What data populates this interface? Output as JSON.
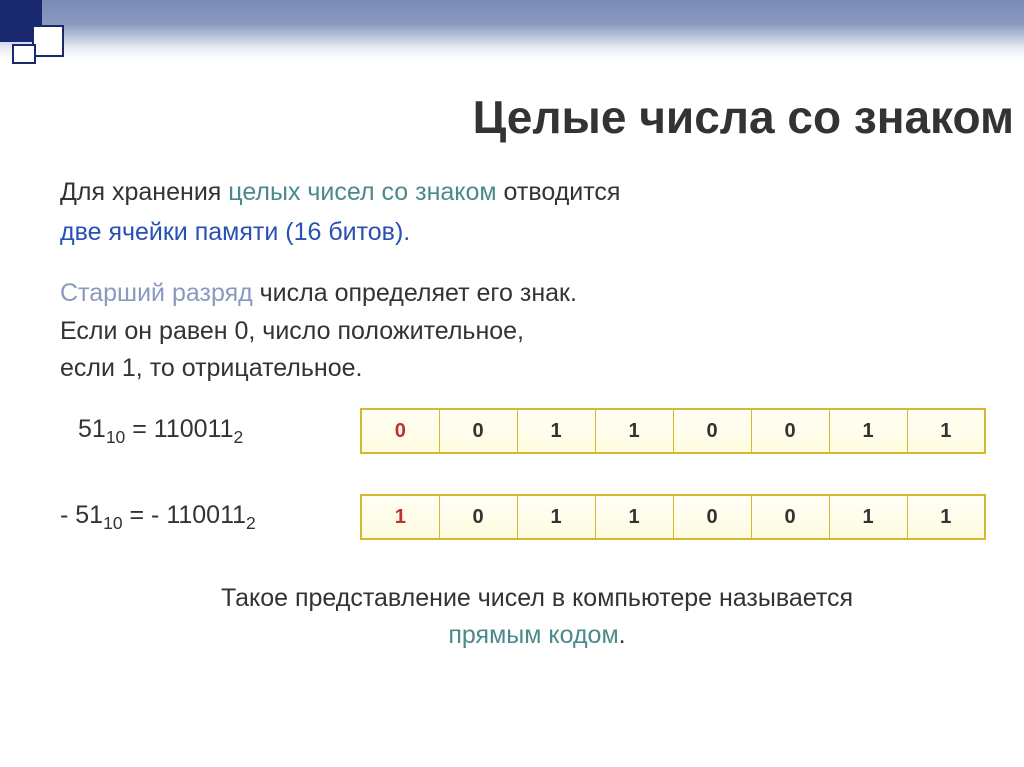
{
  "title": "Целые числа со знаком",
  "para1_a": "Для хранения ",
  "para1_b": "целых чисел со знаком",
  "para1_c": " отводится",
  "para2": "две ячейки памяти (16 битов).",
  "para3_a": "Старший разряд",
  "para3_b": " числа определяет его знак.",
  "para3_c": "Если он равен 0, число положительное,",
  "para3_d": "если 1, то отрицательное.",
  "eq1_n": "51",
  "eq1_nsub": "10",
  "eq1_eq": " = 110011",
  "eq1_bsub": "2",
  "eq2_prefix": "- 51",
  "eq2_nsub": "10",
  "eq2_eq": " = - 110011",
  "eq2_bsub": "2",
  "bits1": [
    "0",
    "0",
    "1",
    "1",
    "0",
    "0",
    "1",
    "1"
  ],
  "bits2": [
    "1",
    "0",
    "1",
    "1",
    "0",
    "0",
    "1",
    "1"
  ],
  "footer_a": "Такое представление чисел в компьютере называется",
  "footer_b": "прямым кодом",
  "footer_c": "."
}
